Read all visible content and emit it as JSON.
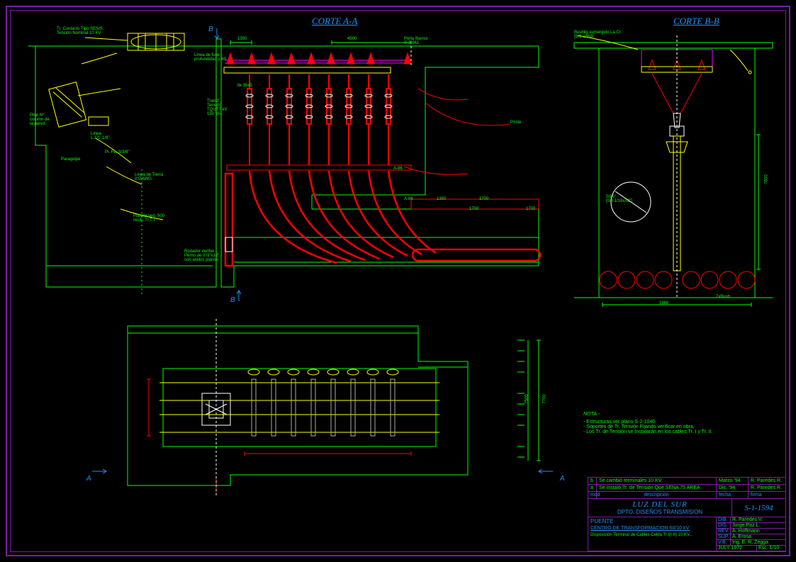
{
  "sections": {
    "corte_aa": "CORTE A-A",
    "corte_bb": "CORTE B-B"
  },
  "annotations": {
    "a1": "Tr. Contacto Tipo SES/S",
    "a1b": "Tención Nominal 10 KV",
    "a2": "Linea de fuse",
    "a2b": "profundidad 1.60",
    "a3": "Porta Barros",
    "a3b": "S-3-661",
    "a4": "1350",
    "a5": "4500",
    "a6": "lle 35x5",
    "a7": "Transf.",
    "a7b": "Tensión",
    "a7c": "TQUTT kV",
    "a7d": "150 VA",
    "a8": "Linea de Tierra",
    "a8b": "0'/ZAWG",
    "a9": "Planilla seg. 500",
    "a9b": "recib. Tr,T,T",
    "a10": "Pi. Fe. 3/3/8\"",
    "a11": "Paragolpe",
    "a12": "Pilar N°",
    "a12b": "column de",
    "a12c": "la pared",
    "a13": "Linea",
    "a13b": "L.1/1'.1/8\"",
    "a14": "Rodador verifier",
    "a14b": "Perno de 0'/3\"x12\"",
    "a14c": "con anillos planos",
    "a15": "A-86",
    "a16": "A-86",
    "a17": "1350",
    "a18": "1700",
    "a19": "1700",
    "a20": "1700",
    "a21": "7500",
    "a22": "7700",
    "a23": "Poste",
    "b1": "Bushlig sumergido La Cr.",
    "b1b": "[b-1-1868]",
    "b2": "0/16\"",
    "b2b": "[0/3 1/16x32\"]",
    "b3": "7600",
    "b4": "1668",
    "b5": "7xBush",
    "ref_a": "A",
    "ref_b": "B"
  },
  "notes": {
    "title": "NOTA.-",
    "line1": "- Estructuras ver plano S-2-1040.",
    "line2": "- Soportes de Tr. Tensión Fijando verificar en obra.",
    "line3": "- Los Tr. de Tensión se Instalarán en los cables Tr. I y Tr. II."
  },
  "titleblock": {
    "rev_b": "b",
    "rev_b_desc": "Se cambió terminales 10 KV",
    "rev_b_date": "Marzo '94",
    "rev_b_sign": "R. Paredes R.",
    "rev_a": "a",
    "rev_a_desc": "Se Instaló Tr. de Tensión Que SENA 75 AREA",
    "rev_a_date": "Dic. '94",
    "rev_a_sign": "R. Paredes R.",
    "header_mod": "mod",
    "header_desc": "descripción",
    "header_date": "fecha",
    "header_sign": "firma",
    "org1": "LUZ DEL SUR",
    "org2": "DPTO. DISEÑOS TRANSMISION",
    "dwg_no": "S-1-1594",
    "project": "PUENTE",
    "subtitle": "CENTRO DE TRANSFORMACION 60/10 kV.",
    "desc": "Disposición Terminal de Cables Celda Tr.I(I-II) 10 KV.",
    "r_dib": "DIB.",
    "r_dib_v": "R. Paredes V.",
    "r_dis": "DIS.",
    "r_dis_v": "Jorge Paz L.",
    "r_rev": "REV.",
    "r_rev_v": "A. Hoffmann",
    "r_sup": "SUP.",
    "r_sup_v": "A. Erosa",
    "r_vb": "V.B.",
    "r_vb_v": "Ing. E. R. Zegga",
    "date": "JULY 1972",
    "scale": "Esc. 1/10"
  }
}
